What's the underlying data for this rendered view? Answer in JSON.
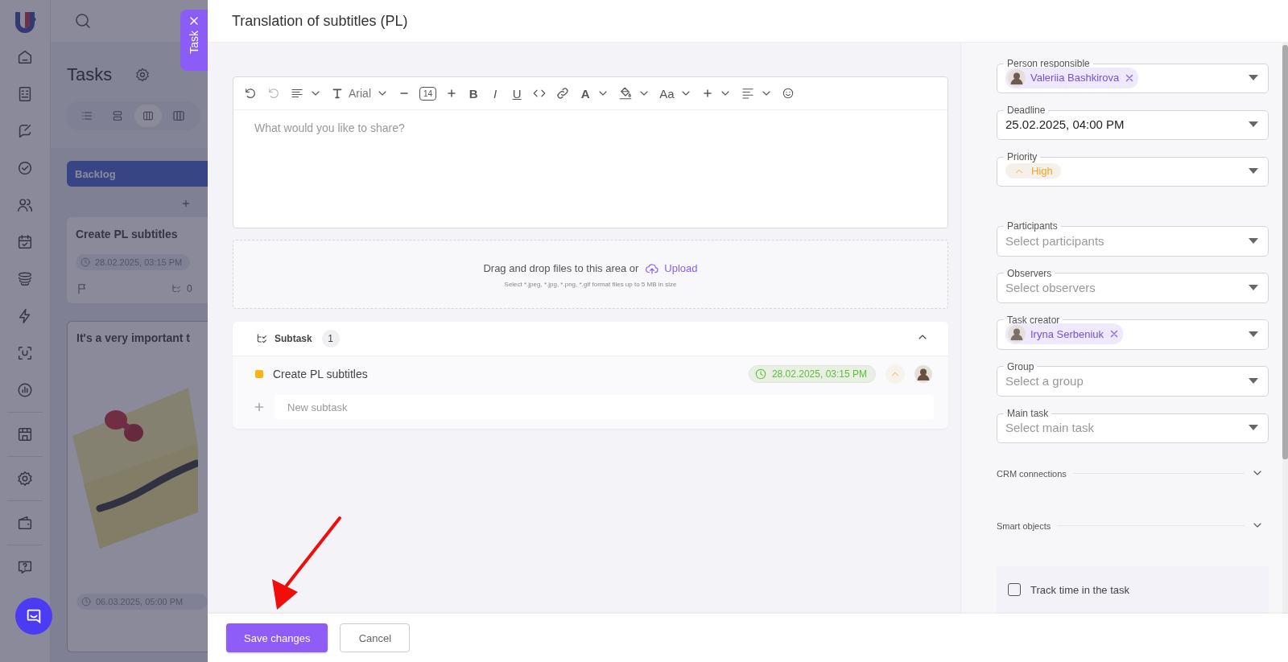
{
  "background_page": {
    "title": "Tasks",
    "column": {
      "title": "Backlog"
    },
    "cards": [
      {
        "kind": "plain",
        "title": "Create PL subtitles",
        "date": "28.02.2025, 03:15 PM",
        "subtask_count": "0"
      },
      {
        "kind": "picture",
        "title": "It's a very important t",
        "date": "06.03.2025, 05:00 PM"
      }
    ]
  },
  "task_tab": {
    "label": "Task"
  },
  "modal": {
    "title": "Translation of subtitles (PL)",
    "editor": {
      "font": "Arial",
      "font_size": "14",
      "glyphs": {
        "bold": "B",
        "italic": "I",
        "underline": "U",
        "text_color": "A",
        "case": "Aa"
      },
      "placeholder": "What would you like to share?"
    },
    "upload": {
      "text": "Drag and drop files to this area or",
      "link": "Upload",
      "hint": "Select *.jpeg, *.jpg, *.png, *.gif format files up to 5 MB in size"
    },
    "subtasks": {
      "title": "Subtask",
      "count": "1",
      "expanded": true,
      "items": [
        {
          "title": "Create PL subtitles",
          "date": "28.02.2025, 03:15 PM",
          "color": "#fbb316"
        }
      ],
      "new_placeholder": "New subtask"
    },
    "fields": [
      {
        "kind": "person",
        "label": "Person responsible",
        "value": "Valeriia Bashkirova"
      },
      {
        "kind": "text",
        "label": "Deadline",
        "value": "25.02.2025, 04:00 PM"
      },
      {
        "kind": "priority",
        "label": "Priority",
        "value": "High"
      },
      {
        "kind": "select",
        "label": "Participants",
        "placeholder": "Select participants"
      },
      {
        "kind": "select",
        "label": "Observers",
        "placeholder": "Select observers"
      },
      {
        "kind": "person",
        "label": "Task creator",
        "value": "Iryna Serbeniuk"
      },
      {
        "kind": "select",
        "label": "Group",
        "placeholder": "Select a group"
      },
      {
        "kind": "select",
        "label": "Main task",
        "placeholder": "Select main task"
      }
    ],
    "sections": [
      {
        "title": "CRM connections",
        "expanded": false
      },
      {
        "title": "Smart objects",
        "expanded": false
      }
    ],
    "track_time": {
      "label": "Track time in the task",
      "checked": false
    },
    "buttons": {
      "save": "Save changes",
      "cancel": "Cancel"
    }
  }
}
